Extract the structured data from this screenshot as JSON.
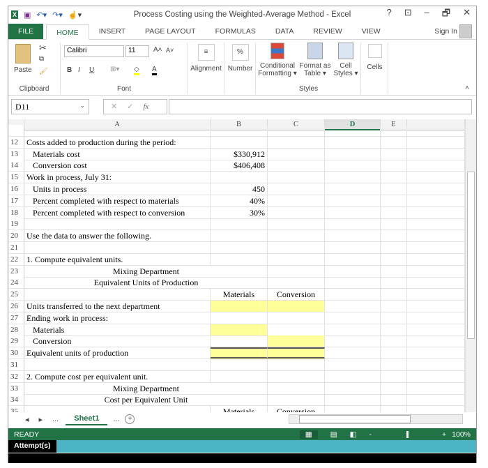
{
  "window": {
    "title": "Process Costing using the Weighted-Average Method - Excel",
    "controls": [
      "?",
      "⊡",
      "–",
      "🗗",
      "✕"
    ]
  },
  "tabs": [
    "FILE",
    "HOME",
    "INSERT",
    "PAGE LAYOUT",
    "FORMULAS",
    "DATA",
    "REVIEW",
    "VIEW"
  ],
  "sign_in": "Sign In",
  "ribbon": {
    "paste": "Paste",
    "font_name": "Calibri",
    "font_size": "11",
    "bold": "B",
    "italic": "I",
    "underline": "U",
    "alignment": "Alignment",
    "number": "Number",
    "percent": "%",
    "cond_fmt": [
      "Conditional",
      "Formatting ▾"
    ],
    "fmt_table": [
      "Format as",
      "Table ▾"
    ],
    "cell_styles": [
      "Cell",
      "Styles ▾"
    ],
    "cells": "Cells",
    "groups": {
      "clipboard": "Clipboard",
      "font": "Font",
      "styles": "Styles"
    }
  },
  "formula_bar": {
    "name_box": "D11",
    "fx": "fx",
    "value": ""
  },
  "columns": [
    "A",
    "B",
    "C",
    "D",
    "E"
  ],
  "selected_column": "D",
  "rows": [
    {
      "n": "",
      "a": "",
      "b": "",
      "c": ""
    },
    {
      "n": "12",
      "a": "Costs added to production during the period:",
      "b": "",
      "c": ""
    },
    {
      "n": "13",
      "a": "   Materials cost",
      "b": "$330,912",
      "c": ""
    },
    {
      "n": "14",
      "a": "   Conversion cost",
      "b": "$406,408",
      "c": ""
    },
    {
      "n": "15",
      "a": "Work in process, July 31:",
      "b": "",
      "c": ""
    },
    {
      "n": "16",
      "a": "   Units in process",
      "b": "450",
      "c": ""
    },
    {
      "n": "17",
      "a": "   Percent completed with respect to materials",
      "b": "40%",
      "c": ""
    },
    {
      "n": "18",
      "a": "   Percent completed with respect to conversion",
      "b": "30%",
      "c": ""
    },
    {
      "n": "19",
      "a": "",
      "b": "",
      "c": ""
    },
    {
      "n": "20",
      "a": "Use the data to answer the following.",
      "b": "",
      "c": ""
    },
    {
      "n": "21",
      "a": "",
      "b": "",
      "c": ""
    },
    {
      "n": "22",
      "a": "1. Compute equivalent units.",
      "b": "",
      "c": ""
    },
    {
      "n": "23",
      "a": "Mixing Department",
      "b": "",
      "c": "",
      "center": true
    },
    {
      "n": "24",
      "a": "Equivalent Units of Production",
      "b": "",
      "c": "",
      "center": true
    },
    {
      "n": "25",
      "a": "",
      "b": "Materials",
      "c": "Conversion"
    },
    {
      "n": "26",
      "a": "Units transferred to the next department",
      "b": "",
      "c": "",
      "yb": true,
      "yc": true
    },
    {
      "n": "27",
      "a": "Ending work in process:",
      "b": "",
      "c": ""
    },
    {
      "n": "28",
      "a": "   Materials",
      "b": "",
      "c": "",
      "yb": true
    },
    {
      "n": "29",
      "a": "   Conversion",
      "b": "",
      "c": "",
      "yc": true
    },
    {
      "n": "30",
      "a": "Equivalent units of production",
      "b": "",
      "c": "",
      "yb": true,
      "yc": true,
      "total": true
    },
    {
      "n": "31",
      "a": "",
      "b": "",
      "c": ""
    },
    {
      "n": "32",
      "a": "2. Compute cost per equivalent unit.",
      "b": "",
      "c": ""
    },
    {
      "n": "33",
      "a": "Mixing Department",
      "b": "",
      "c": "",
      "center": true
    },
    {
      "n": "34",
      "a": "Cost per Equivalent Unit",
      "b": "",
      "c": "",
      "center": true
    },
    {
      "n": "35",
      "a": "",
      "b": "Materials",
      "c": "Conversion"
    }
  ],
  "sheet_tabs": {
    "active": "Sheet1",
    "nav": [
      "◂",
      "▸",
      "..."
    ],
    "more": "...",
    "add": "+"
  },
  "status": {
    "text": "READY",
    "zoom_minus": "-",
    "zoom_plus": "+",
    "zoom": "100%"
  },
  "attempt_label": "Attempt(s)",
  "colors": {
    "excel_green": "#217346",
    "input_yellow": "#ffff99",
    "attempt_bar": "#4bb3c4"
  }
}
